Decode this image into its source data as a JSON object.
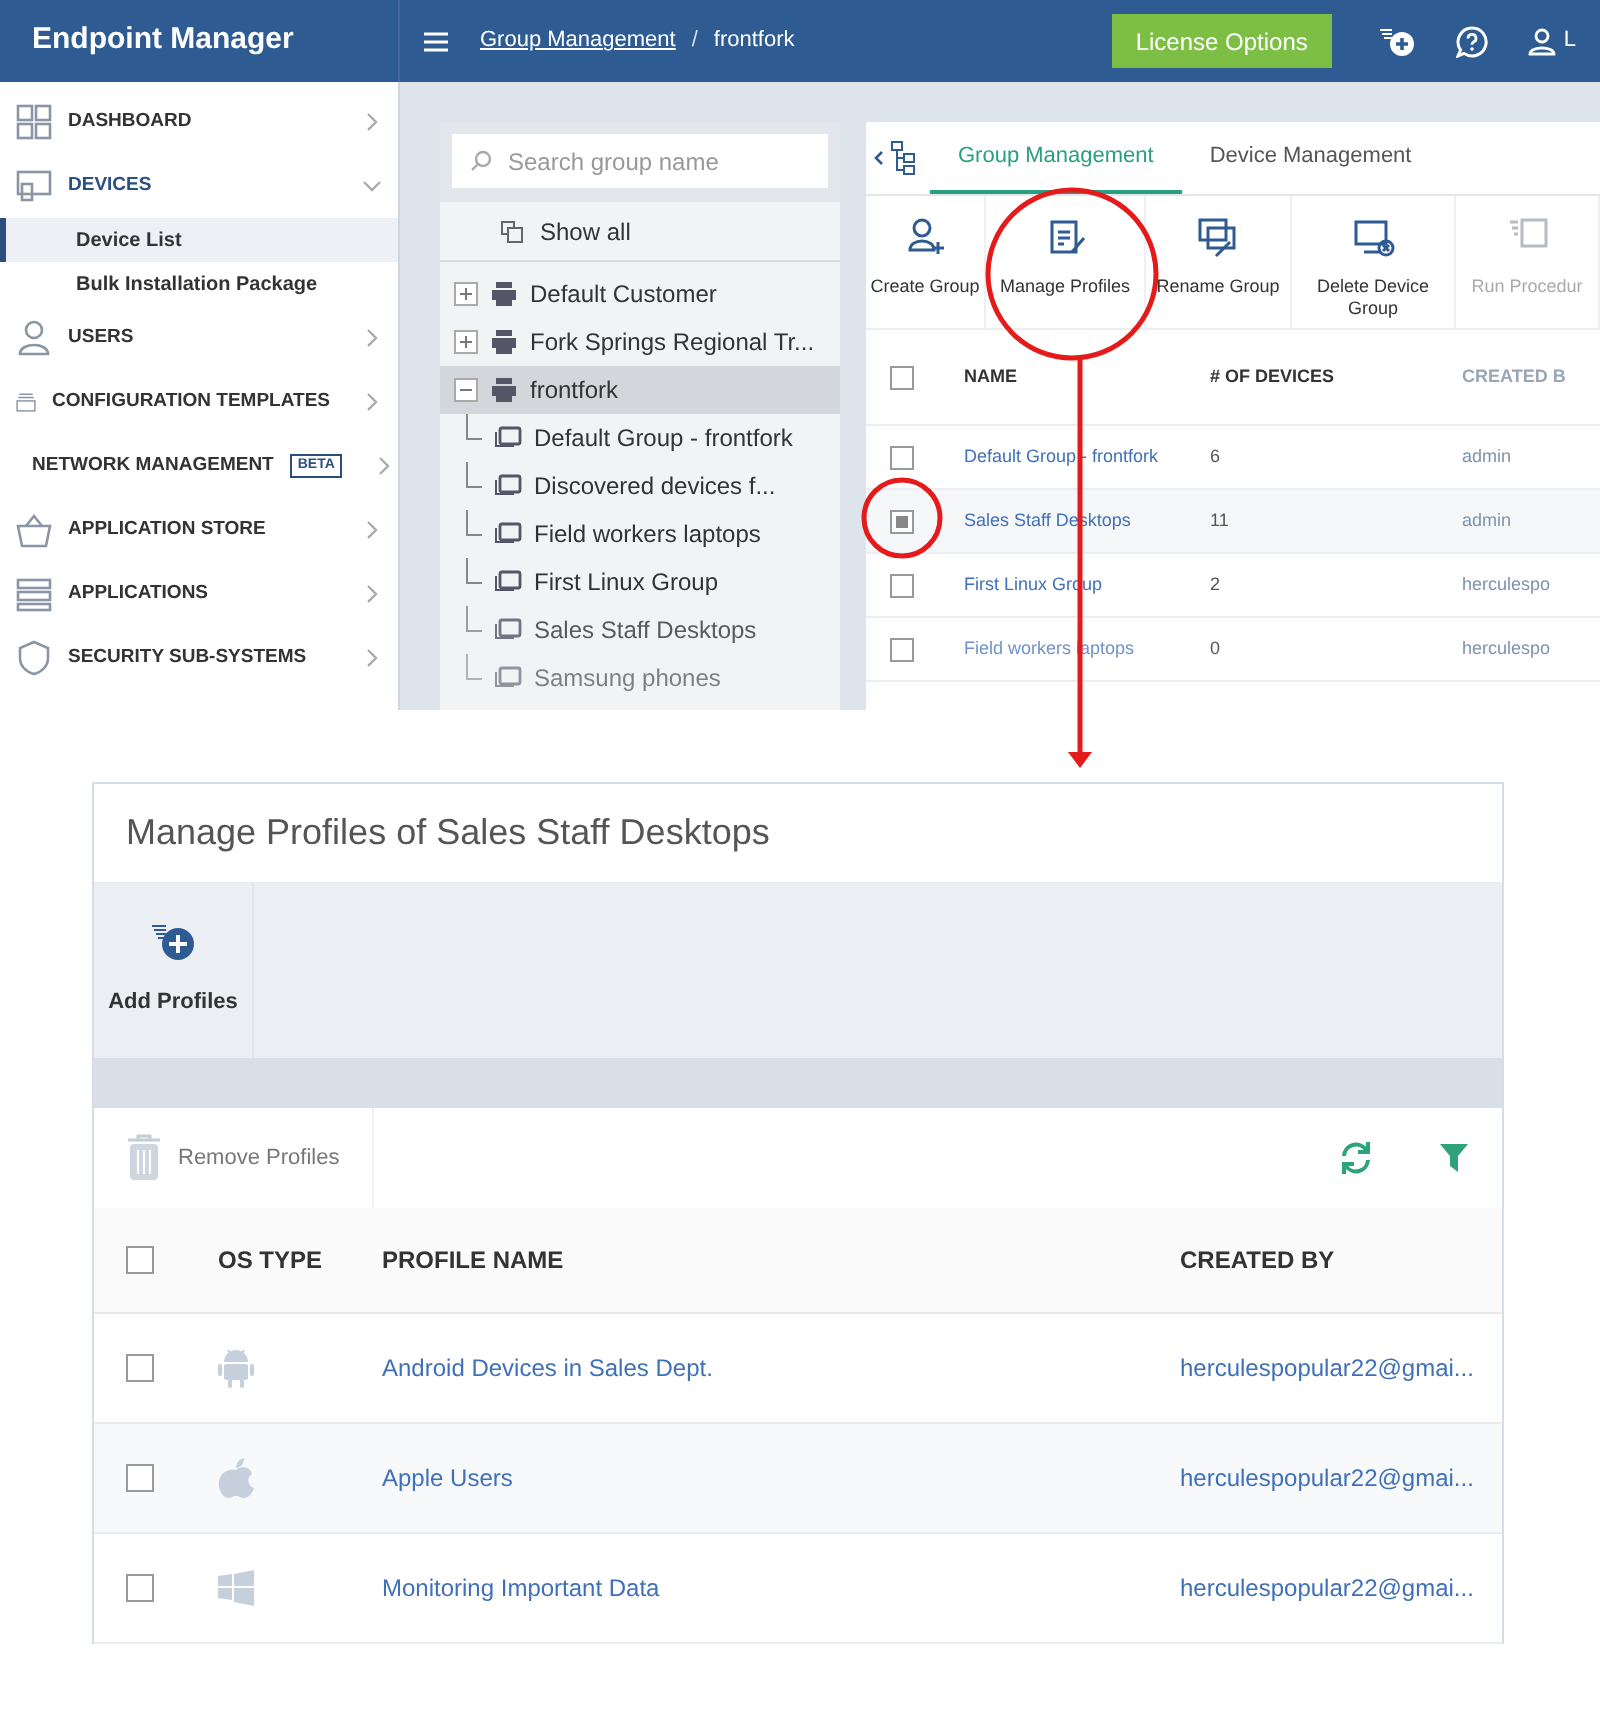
{
  "header": {
    "title": "Endpoint Manager",
    "breadcrumb": [
      {
        "label": "Group Management",
        "link": true
      },
      {
        "label": "frontfork",
        "link": false
      }
    ],
    "breadcrumb_separator": "/",
    "license_button": "License Options",
    "user_label": "L"
  },
  "sidebar": {
    "items": [
      {
        "label": "DASHBOARD",
        "expanded": false
      },
      {
        "label": "DEVICES",
        "expanded": true,
        "children": [
          {
            "label": "Device List",
            "selected": true
          },
          {
            "label": "Bulk Installation Package",
            "selected": false
          }
        ]
      },
      {
        "label": "USERS",
        "expanded": false
      },
      {
        "label": "CONFIGURATION TEMPLATES",
        "expanded": false
      },
      {
        "label": "NETWORK MANAGEMENT",
        "expanded": false,
        "badge": "BETA"
      },
      {
        "label": "APPLICATION STORE",
        "expanded": false
      },
      {
        "label": "APPLICATIONS",
        "expanded": false
      },
      {
        "label": "SECURITY SUB-SYSTEMS",
        "expanded": false
      }
    ]
  },
  "group_tree": {
    "search": {
      "placeholder": "Search group name"
    },
    "show_all": "Show all",
    "nodes": [
      {
        "label": "Default Customer",
        "expanded": false,
        "selected": false
      },
      {
        "label": "Fork Springs Regional Tr...",
        "expanded": false,
        "selected": false
      },
      {
        "label": "frontfork",
        "expanded": true,
        "selected": true,
        "children": [
          {
            "label": "Default Group - frontfork"
          },
          {
            "label": "Discovered devices f..."
          },
          {
            "label": "Field workers laptops"
          },
          {
            "label": "First Linux Group"
          },
          {
            "label": "Sales Staff Desktops"
          },
          {
            "label": "Samsung phones"
          }
        ]
      }
    ]
  },
  "tabs": [
    {
      "label": "Group Management",
      "selected": true
    },
    {
      "label": "Device Management",
      "selected": false
    }
  ],
  "toolbar": [
    {
      "label": "Create Group",
      "disabled": false
    },
    {
      "label": "Manage Profiles",
      "disabled": false
    },
    {
      "label": "Rename Group",
      "disabled": false
    },
    {
      "label": "Delete Device Group",
      "disabled": false
    },
    {
      "label": "Run Procedur",
      "disabled": true
    }
  ],
  "groups_table": {
    "all_checked": false,
    "columns": [
      "NAME",
      "# OF DEVICES",
      "CREATED B"
    ],
    "rows": [
      {
        "checked": false,
        "cells": [
          "Default Group - frontfork",
          "6",
          "admin"
        ]
      },
      {
        "checked": true,
        "cells": [
          "Sales Staff Desktops",
          "11",
          "admin"
        ]
      },
      {
        "checked": false,
        "cells": [
          "First Linux Group",
          "2",
          "herculespo"
        ]
      },
      {
        "checked": false,
        "cells": [
          "Field workers laptops",
          "0",
          "herculespo"
        ]
      }
    ]
  },
  "dialog": {
    "title": "Manage Profiles of Sales Staff Desktops",
    "add_button": "Add Profiles",
    "remove_button": "Remove Profiles",
    "all_checked": false,
    "columns": [
      "OS TYPE",
      "PROFILE NAME",
      "CREATED BY"
    ],
    "rows": [
      {
        "checked": false,
        "kind": "android",
        "name": "Android Devices in Sales Dept.",
        "created_by": "herculespopular22@gmai..."
      },
      {
        "checked": false,
        "kind": "apple",
        "name": "Apple Users",
        "created_by": "herculespopular22@gmai..."
      },
      {
        "checked": false,
        "kind": "windows",
        "name": "Monitoring Important Data",
        "created_by": "herculespopular22@gmai..."
      }
    ]
  }
}
